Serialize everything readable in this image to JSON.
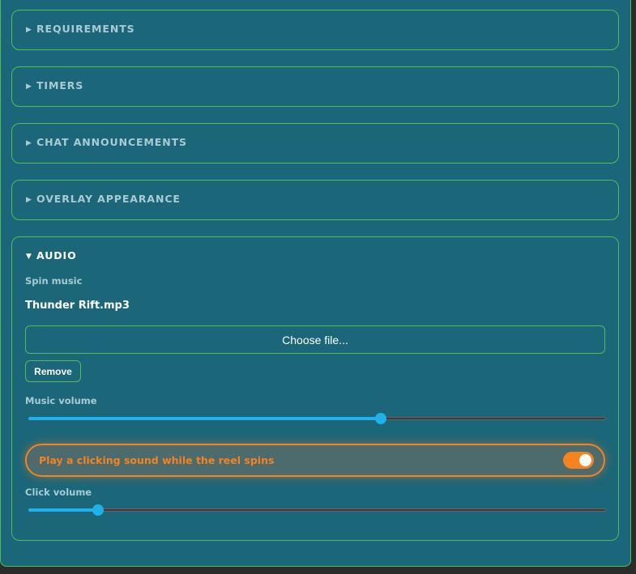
{
  "sections": [
    {
      "title": "REQUIREMENTS",
      "arrow": "▶"
    },
    {
      "title": "TIMERS",
      "arrow": "▶"
    },
    {
      "title": "CHAT ANNOUNCEMENTS",
      "arrow": "▶"
    },
    {
      "title": "OVERLAY APPEARANCE",
      "arrow": "▶"
    }
  ],
  "audio": {
    "title": "AUDIO",
    "arrow": "▼",
    "spin_music_label": "Spin music",
    "file_name": "Thunder Rift.mp3",
    "choose_file_label": "Choose file...",
    "remove_label": "Remove",
    "music_volume_label": "Music volume",
    "music_volume": 0.61,
    "click_sound_label": "Play a clicking sound while the reel spins",
    "click_sound_enabled": true,
    "click_volume_label": "Click volume",
    "click_volume": 0.12
  },
  "colors": {
    "panel_bg": "#1b6679",
    "border_green": "#4fbf55",
    "accent_blue": "#1fb2e8",
    "accent_orange": "#f5831f"
  }
}
